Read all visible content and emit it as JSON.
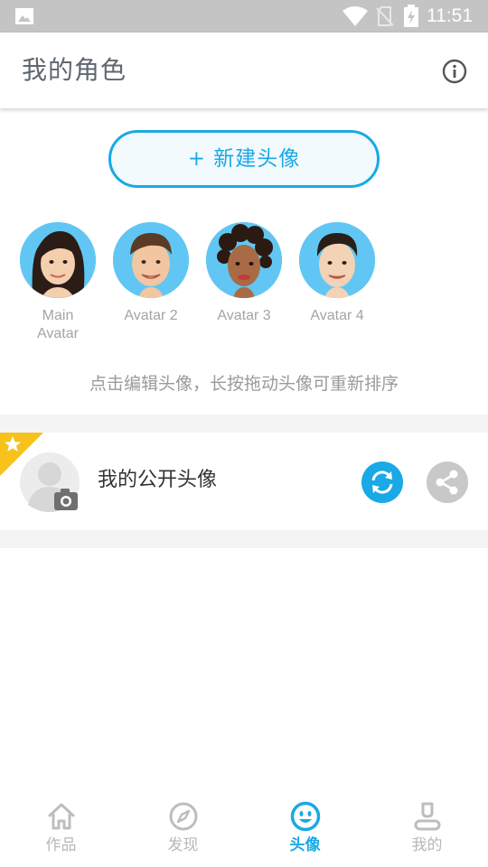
{
  "status_bar": {
    "time": "11:51",
    "icons": [
      "gallery-icon",
      "wifi-icon",
      "no-sim-icon",
      "battery-charging-icon"
    ]
  },
  "header": {
    "title": "我的角色",
    "info_icon": "info-icon"
  },
  "new_avatar_button": {
    "label": "+ 新建头像"
  },
  "avatars": [
    {
      "label": "Main\nAvatar"
    },
    {
      "label": "Avatar 2"
    },
    {
      "label": "Avatar 3"
    },
    {
      "label": "Avatar 4"
    }
  ],
  "hint": "点击编辑头像，长按拖动头像可重新排序",
  "public_avatar": {
    "name": "我的公开头像",
    "icons": [
      "star-icon",
      "camera-icon",
      "sync-icon",
      "share-icon"
    ]
  },
  "bottom_nav": [
    {
      "label": "作品",
      "icon": "home-icon",
      "active": false
    },
    {
      "label": "发现",
      "icon": "compass-icon",
      "active": false
    },
    {
      "label": "头像",
      "icon": "smiley-icon",
      "active": true
    },
    {
      "label": "我的",
      "icon": "person-icon",
      "active": false
    }
  ],
  "colors": {
    "accent": "#18a9e6",
    "avatar_bg": "#61c6f3",
    "star_badge": "#f6c21b",
    "status_bar": "#c4c4c4"
  }
}
